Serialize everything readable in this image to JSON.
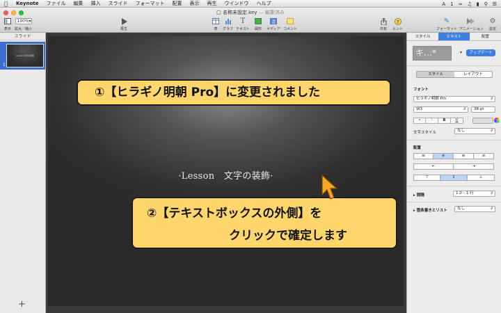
{
  "menubar": {
    "app": "Keynote",
    "items": [
      "ファイル",
      "編集",
      "挿入",
      "スライド",
      "フォーマット",
      "配置",
      "表示",
      "再生",
      "ウインドウ",
      "ヘルプ"
    ],
    "status": [
      "A",
      "1",
      "Q"
    ]
  },
  "window": {
    "doc_title": "名称未設定.key",
    "doc_status": "— 編集済み"
  },
  "toolbar": {
    "view_label": "表示",
    "zoom_value": "100%",
    "zoom_label": "拡大／縮小",
    "play_label": "再生",
    "table_label": "表",
    "chart_label": "グラフ",
    "text_label": "テキスト",
    "shape_label": "図形",
    "media_label": "メディア",
    "comment_label": "コメント",
    "share_label": "共有",
    "tips_label": "ヒント",
    "format_label": "フォーマット",
    "animate_label": "アニメーション",
    "document_label": "設定"
  },
  "navigator": {
    "header": "スライド",
    "slide_number": "1",
    "thumb_text": "Lesson 文字の装飾",
    "add_label": "+"
  },
  "slide": {
    "text": "·Lesson　文字の装飾·"
  },
  "callouts": {
    "c1": "①【ヒラギノ明朝 Pro】に変更されました",
    "c2_line1": "②【テキストボックスの外側】を",
    "c2_line2": "クリックで確定します"
  },
  "inspector": {
    "tabs": [
      "スタイル",
      "テキスト",
      "配置"
    ],
    "active_tab": 1,
    "preview_text": "キ…*",
    "update_label": "アップデート",
    "seg_style": "スタイル",
    "seg_layout": "レイアウト",
    "font_label": "フォント",
    "font_name": "ヒラギノ明朝 Pro",
    "font_weight": "W3",
    "font_size": "38 pt",
    "bold": "B",
    "underline": "U",
    "char_style_label": "文字スタイル",
    "char_style_value": "なし",
    "align_label": "配置",
    "spacing_label": "間隔",
    "spacing_value": "1.0 – 1 行",
    "bullets_label": "箇条書きとリスト",
    "bullets_value": "なし"
  },
  "colors": {
    "accent": "#3b82e0",
    "callout_fill": "#ffd66b",
    "cursor": "#f5a623"
  }
}
